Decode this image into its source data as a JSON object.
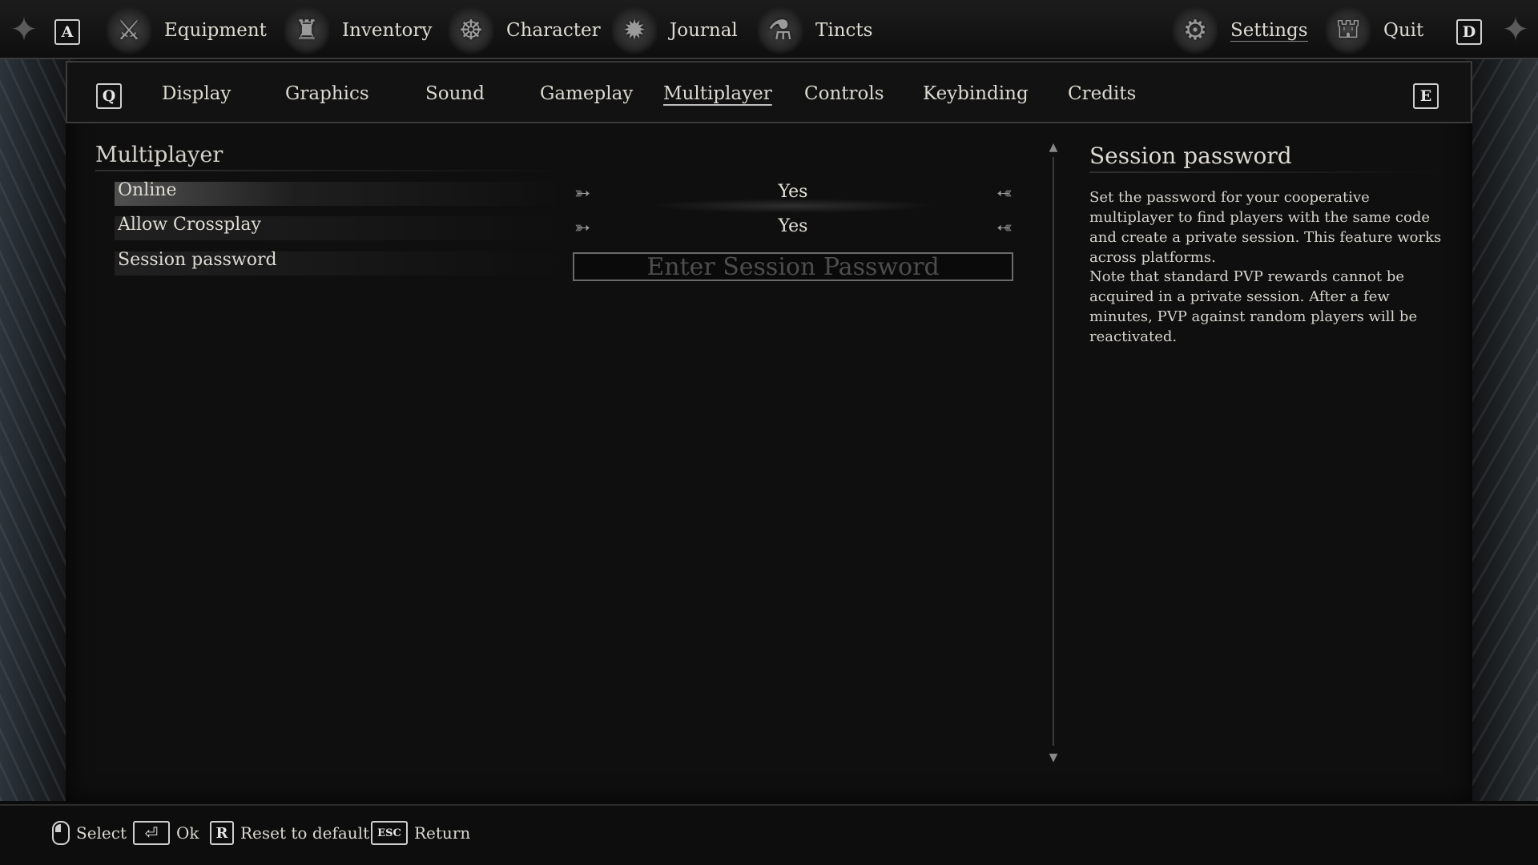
{
  "topnav": {
    "left_key": "A",
    "right_key": "D",
    "items": [
      {
        "label": "Equipment",
        "icon": "equipment-icon",
        "glyph": "⚔"
      },
      {
        "label": "Inventory",
        "icon": "inventory-icon",
        "glyph": "♜"
      },
      {
        "label": "Character",
        "icon": "character-icon",
        "glyph": "☸"
      },
      {
        "label": "Journal",
        "icon": "journal-icon",
        "glyph": "✹"
      },
      {
        "label": "Tincts",
        "icon": "tincts-icon",
        "glyph": "⚗"
      }
    ],
    "settings": {
      "label": "Settings",
      "icon": "settings-icon",
      "glyph": "⚙"
    },
    "quit": {
      "label": "Quit",
      "icon": "quit-icon",
      "glyph": "⛫"
    }
  },
  "subnav": {
    "left_key": "Q",
    "right_key": "E",
    "tabs": [
      "Display",
      "Graphics",
      "Sound",
      "Gameplay",
      "Multiplayer",
      "Controls",
      "Keybinding",
      "Credits"
    ],
    "active": "Multiplayer"
  },
  "section": {
    "title": "Multiplayer",
    "rows": [
      {
        "label": "Online",
        "value": "Yes"
      },
      {
        "label": "Allow Crossplay",
        "value": "Yes"
      },
      {
        "label": "Session password",
        "placeholder": "Enter Session Password"
      }
    ]
  },
  "info": {
    "title": "Session password",
    "paragraph1": "Set the password for your cooperative multiplayer to find players with the same code and create a private session. This feature works across platforms.",
    "paragraph2": "Note that standard PVP rewards cannot be acquired in a private session. After a few minutes, PVP against random players will be reactivated."
  },
  "hints": {
    "select": {
      "label": "Select"
    },
    "ok": {
      "label": "Ok",
      "key_glyph": "⏎"
    },
    "reset": {
      "label": "Reset to default",
      "key": "R"
    },
    "return": {
      "label": "Return",
      "key": "ESC"
    }
  },
  "colors": {
    "background": "#0b0b0b",
    "text": "#dedbd3",
    "placeholder": "#4d4d4d",
    "border": "#3b3b3b"
  }
}
